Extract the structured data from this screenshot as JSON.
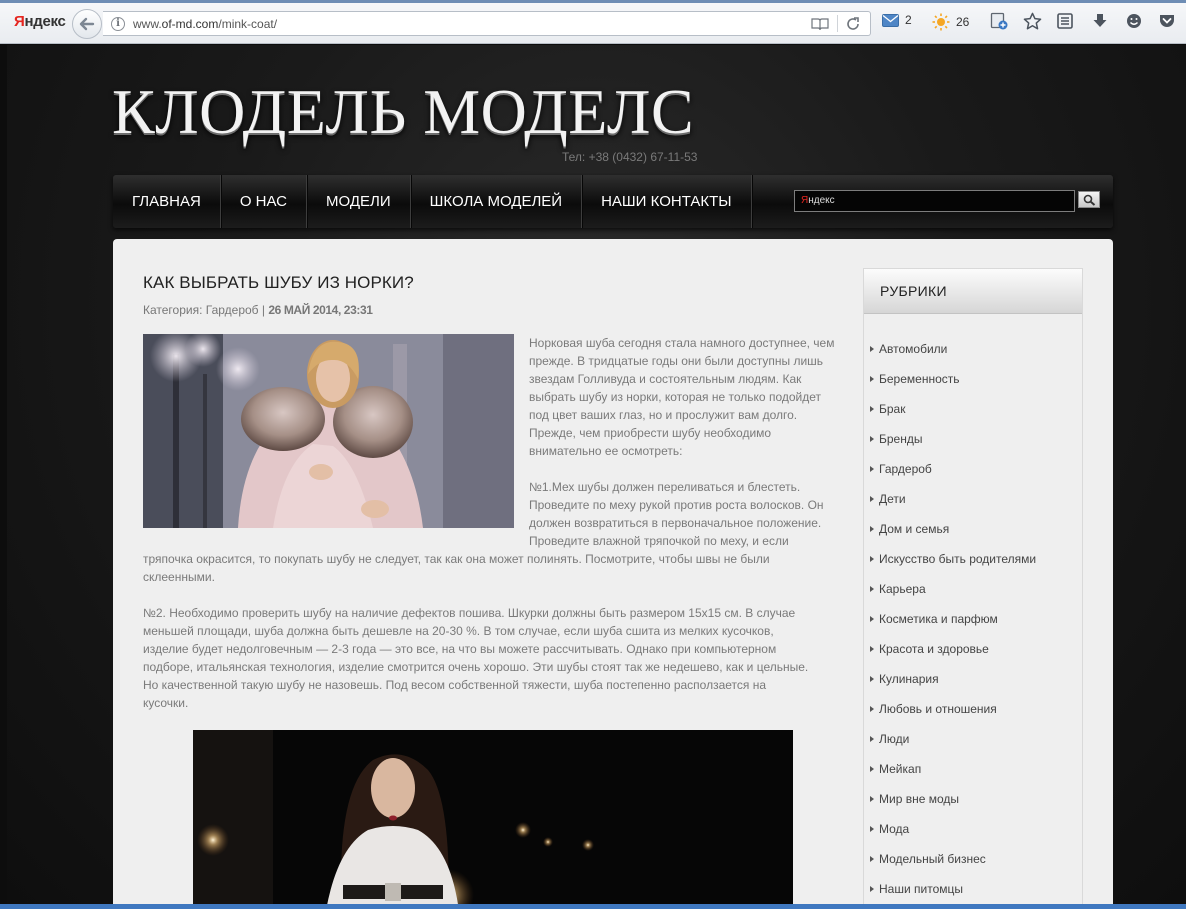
{
  "browser": {
    "brand": "Яндекс",
    "url_prefix": "www.",
    "url_domain": "of-md.com",
    "url_path": "/mink-coat/",
    "mail_count": "2",
    "weather_temp": "26",
    "icons": [
      "back-arrow-icon",
      "info-icon",
      "reader-mode-icon",
      "reload-icon",
      "mail-icon",
      "sun-icon",
      "bookmark-page-icon",
      "star-icon",
      "notes-icon",
      "download-icon",
      "smile-icon",
      "pocket-icon"
    ],
    "accent": "#3b78c3"
  },
  "site": {
    "title": "КЛОДЕЛЬ МОДЕЛС",
    "phone": "Тел: +38 (0432) 67-11-53",
    "nav": [
      "ГЛАВНАЯ",
      "О НАС",
      "МОДЕЛИ",
      "ШКОЛА МОДЕЛЕЙ",
      "НАШИ КОНТАКТЫ"
    ],
    "search_brand": "Яндекс"
  },
  "article": {
    "title": "КАК ВЫБРАТЬ ШУБУ ИЗ НОРКИ?",
    "meta_category": "Категория: Гардероб | ",
    "meta_date": "26 МАЙ 2014, 23:31",
    "p1": "Норковая шуба сегодня стала намного доступнее, чем прежде. В тридцатые годы они были доступны лишь звездам Голливуда и состоятельным людям. Как выбрать шубу из норки, которая не только подойдет под цвет ваших глаз, но и прослужит вам долго. Прежде, чем приобрести шубу необходимо внимательно ее осмотреть:",
    "p2": "№1.Мех шубы должен переливаться и блестеть. Проведите по меху рукой против роста волосков. Он должен возвратиться в первоначальное положение. Проведите влажной тряпочкой по меху, и если",
    "p2b": "тряпочка окрасится, то покупать шубу не следует, так как она может полинять. Посмотрите, чтобы швы не были склеенными.",
    "p3": "№2. Необходимо проверить шубу на наличие дефектов пошива. Шкурки должны быть размером 15х15 см. В случае меньшей площади, шуба должна быть дешевле на 20-30 %. В том случае, если шуба сшита из мелких кусочков, изделие будет недолговечным — 2-3 года — это все, на что вы можете рассчитывать. Однако при компьютерном подборе, итальянская технология, изделие смотрится очень хорошо. Эти шубы стоят так же недешево, как и цельные. Но качественной такую шубу не назовешь. Под весом собственной тяжести, шуба постепенно расползается на кусочки."
  },
  "sidebar": {
    "title": "РУБРИКИ",
    "items": [
      {
        "label": "Автомобили"
      },
      {
        "label": "Беременность"
      },
      {
        "label": "Брак"
      },
      {
        "label": "Бренды"
      },
      {
        "label": "Гардероб"
      },
      {
        "label": "Дети"
      },
      {
        "label": "Дом и семья"
      },
      {
        "label": "Искусство быть родителями"
      },
      {
        "label": "Карьера"
      },
      {
        "label": "Косметика и парфюм"
      },
      {
        "label": "Красота и здоровье"
      },
      {
        "label": "Кулинария"
      },
      {
        "label": "Любовь и отношения"
      },
      {
        "label": "Люди"
      },
      {
        "label": "Мейкап"
      },
      {
        "label": "Мир вне моды"
      },
      {
        "label": "Мода"
      },
      {
        "label": "Модельный бизнес"
      },
      {
        "label": "Наши питомцы"
      }
    ]
  }
}
